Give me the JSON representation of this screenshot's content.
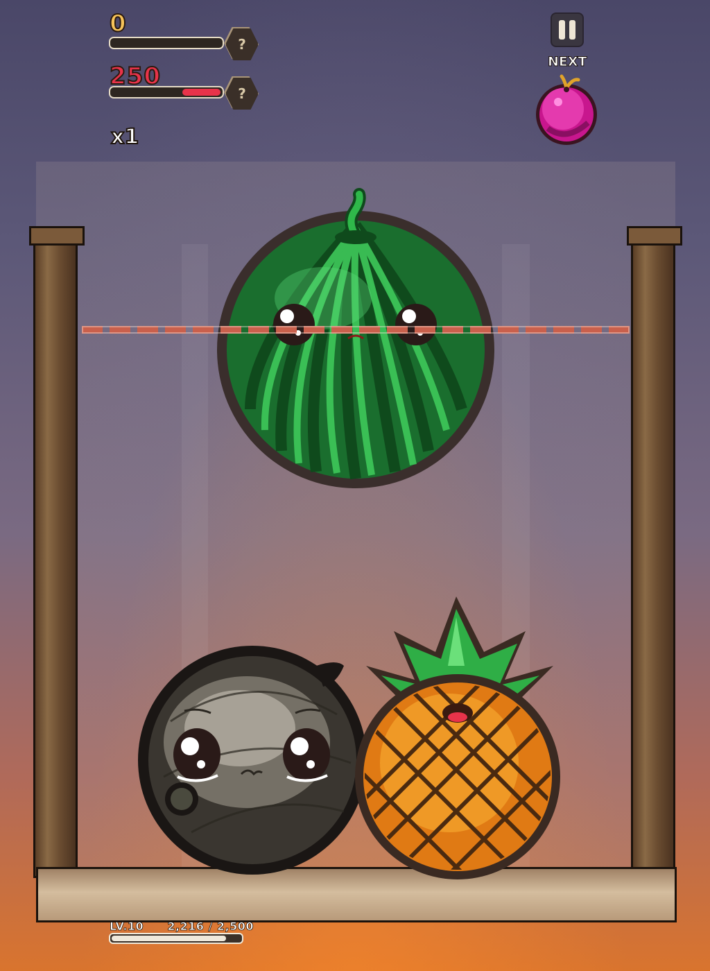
{
  "hud": {
    "score": "0",
    "score_progress": 0.0,
    "target": "250",
    "target_progress": 0.35,
    "hex_badge_1": "?",
    "hex_badge_2": "?",
    "multiplier": "x1",
    "next_label": "NEXT",
    "next_fruit": "plum"
  },
  "board": {
    "fruits": [
      "watermelon",
      "coconut",
      "pineapple"
    ]
  },
  "footer": {
    "level": "LV.10",
    "xp": "2,216 / 2,500",
    "xp_progress": 0.8864
  },
  "colors": {
    "score": "#f6c35a",
    "target": "#e8334a",
    "target_bar": "#e8334a",
    "dash": "#c9604c"
  }
}
